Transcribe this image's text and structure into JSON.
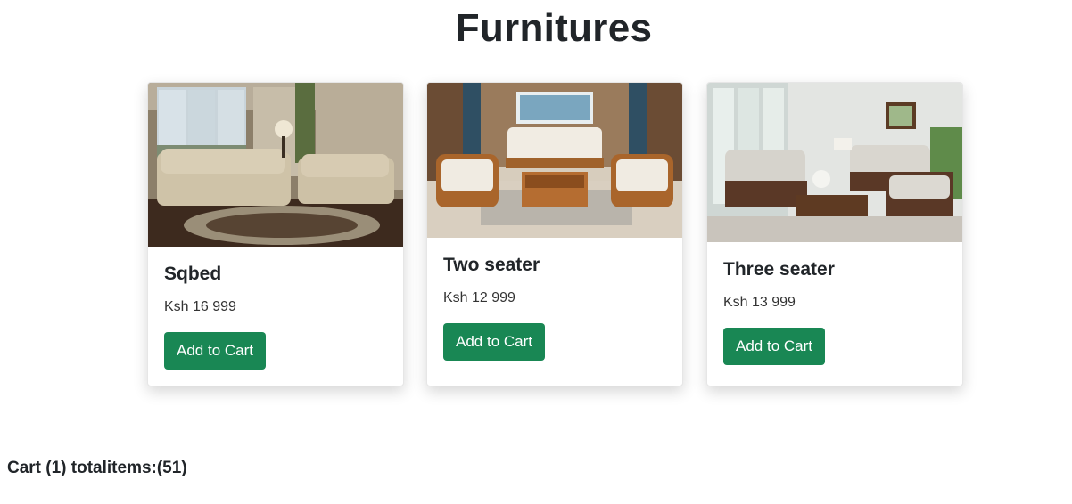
{
  "page": {
    "title": "Furnitures"
  },
  "products": [
    {
      "name": "Sqbed",
      "price": "Ksh 16 999",
      "button_label": "Add to Cart",
      "image": "beige-sofa-set-photo"
    },
    {
      "name": "Two seater",
      "price": "Ksh 12 999",
      "button_label": "Add to Cart",
      "image": "wooden-sofa-set-photo"
    },
    {
      "name": "Three seater",
      "price": "Ksh 13 999",
      "button_label": "Add to Cart",
      "image": "grey-sofa-set-photo"
    }
  ],
  "cart": {
    "summary": "Cart (1) totalitems:(51)"
  },
  "colors": {
    "button": "#198754",
    "text": "#212529"
  }
}
